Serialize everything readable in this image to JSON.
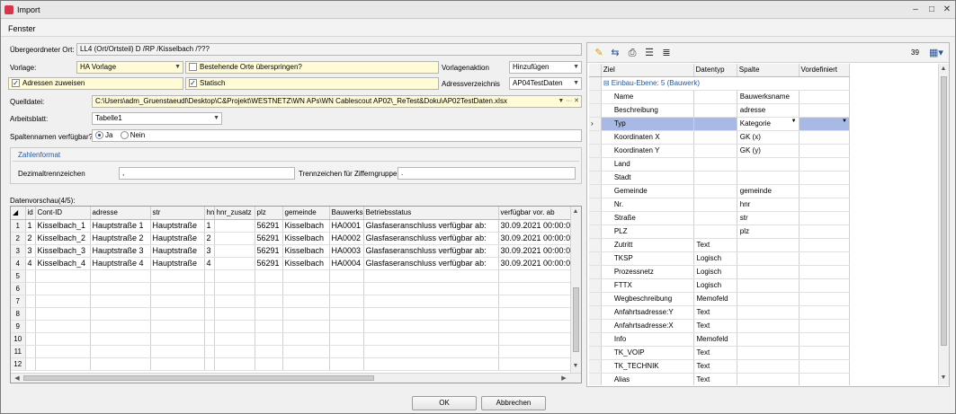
{
  "window": {
    "title": "Import",
    "minimize": "–",
    "maximize": "□",
    "close": "✕"
  },
  "menu": {
    "fenster": "Fenster"
  },
  "form": {
    "uebergeordneter_label": "Übergeordneter Ort:",
    "uebergeordneter_value": "LL4 (Ort/Ortsteil) D /RP /Kisselbach /???",
    "vorlage_label": "Vorlage:",
    "vorlage_value": "HA Vorlage",
    "bestehende_label": "Bestehende Orte überspringen?",
    "vorlageaktion_label": "Vorlagenaktion",
    "vorlageaktion_value": "Hinzufügen",
    "adressen_label": "Adressen zuweisen",
    "statisch_label": "Statisch",
    "adressverz_label": "Adressverzeichnis",
    "adressverz_value": "AP04TestDaten",
    "quelldatei_label": "Quelldatei:",
    "quelldatei_value": "C:\\Users\\adm_Gruenstaeudl\\Desktop\\C&Projekt\\WESTNETZ\\WN APs\\WN Cablescout AP02\\_ReTest&Doku\\AP02TestDaten.xlsx",
    "arbeitsblatt_label": "Arbeitsblatt:",
    "arbeitsblatt_value": "Tabelle1",
    "spalten_label": "Spaltennamen verfügbar?",
    "ja": "Ja",
    "nein": "Nein",
    "zahlenformat": "Zahlenformat",
    "dezimal_label": "Dezimaltrennzeichen",
    "dezimal_value": ",",
    "tausender_label": "Trennzeichen für Zifferngruppe",
    "tausender_value": "."
  },
  "preview": {
    "label": "Datenvorschau(4/5):",
    "columns": [
      "id",
      "Cont-ID",
      "adresse",
      "str",
      "hnr",
      "hnr_zusatz",
      "plz",
      "gemeinde",
      "Bauwerks",
      "Betriebsstatus",
      "verfügbar vor. ab"
    ],
    "rows": [
      [
        "1",
        "Kisselbach_1",
        "Hauptstraße 1",
        "Hauptstraße",
        "1",
        "",
        "56291",
        "Kisselbach",
        "HA0001",
        "Glasfaseranschluss verfügbar ab:",
        "30.09.2021 00:00:0"
      ],
      [
        "2",
        "Kisselbach_2",
        "Hauptstraße 2",
        "Hauptstraße",
        "2",
        "",
        "56291",
        "Kisselbach",
        "HA0002",
        "Glasfaseranschluss verfügbar ab:",
        "30.09.2021 00:00:0"
      ],
      [
        "3",
        "Kisselbach_3",
        "Hauptstraße 3",
        "Hauptstraße",
        "3",
        "",
        "56291",
        "Kisselbach",
        "HA0003",
        "Glasfaseranschluss verfügbar ab:",
        "30.09.2021 00:00:0"
      ],
      [
        "4",
        "Kisselbach_4",
        "Hauptstraße 4",
        "Hauptstraße",
        "4",
        "",
        "56291",
        "Kisselbach",
        "HA0004",
        "Glasfaseranschluss verfügbar ab:",
        "30.09.2021 00:00:0"
      ]
    ],
    "row_numbers": [
      "1",
      "2",
      "3",
      "4",
      "5",
      "6",
      "7",
      "8",
      "9",
      "10",
      "11",
      "12"
    ]
  },
  "mapping": {
    "count": "39",
    "headers": [
      "Ziel",
      "Datentyp",
      "Spalte",
      "Vordefiniert"
    ],
    "group_label": "Einbau-Ebene: 5 (Bauwerk)",
    "rows": [
      {
        "ziel": "Name",
        "typ": "",
        "spalte": "Bauwerksname"
      },
      {
        "ziel": "Beschreibung",
        "typ": "",
        "spalte": "adresse"
      },
      {
        "ziel": "Typ",
        "typ": "",
        "spalte": "Kategorie"
      },
      {
        "ziel": "Koordinaten X",
        "typ": "",
        "spalte": "GK (x)"
      },
      {
        "ziel": "Koordinaten Y",
        "typ": "",
        "spalte": "GK (y)"
      },
      {
        "ziel": "Land",
        "typ": "",
        "spalte": ""
      },
      {
        "ziel": "Stadt",
        "typ": "",
        "spalte": ""
      },
      {
        "ziel": "Gemeinde",
        "typ": "",
        "spalte": "gemeinde"
      },
      {
        "ziel": "Nr.",
        "typ": "",
        "spalte": "hnr"
      },
      {
        "ziel": "Straße",
        "typ": "",
        "spalte": "str"
      },
      {
        "ziel": "PLZ",
        "typ": "",
        "spalte": "plz"
      },
      {
        "ziel": "Zutritt",
        "typ": "Text",
        "spalte": ""
      },
      {
        "ziel": "TKSP",
        "typ": "Logisch",
        "spalte": ""
      },
      {
        "ziel": "Prozessnetz",
        "typ": "Logisch",
        "spalte": ""
      },
      {
        "ziel": "FTTX",
        "typ": "Logisch",
        "spalte": ""
      },
      {
        "ziel": "Wegbeschreibung",
        "typ": "Memofeld",
        "spalte": ""
      },
      {
        "ziel": "Anfahrtsadresse:Y",
        "typ": "Text",
        "spalte": ""
      },
      {
        "ziel": "Anfahrtsadresse:X",
        "typ": "Text",
        "spalte": ""
      },
      {
        "ziel": "Info",
        "typ": "Memofeld",
        "spalte": ""
      },
      {
        "ziel": "TK_VOIP",
        "typ": "Text",
        "spalte": ""
      },
      {
        "ziel": "TK_TECHNIK",
        "typ": "Text",
        "spalte": ""
      },
      {
        "ziel": "Alias",
        "typ": "Text",
        "spalte": ""
      }
    ]
  },
  "buttons": {
    "ok": "OK",
    "abbrechen": "Abbrechen"
  },
  "icons": [
    "wand-icon",
    "import-icon",
    "print-icon",
    "list-icon",
    "list2-icon",
    "grid-icon"
  ]
}
